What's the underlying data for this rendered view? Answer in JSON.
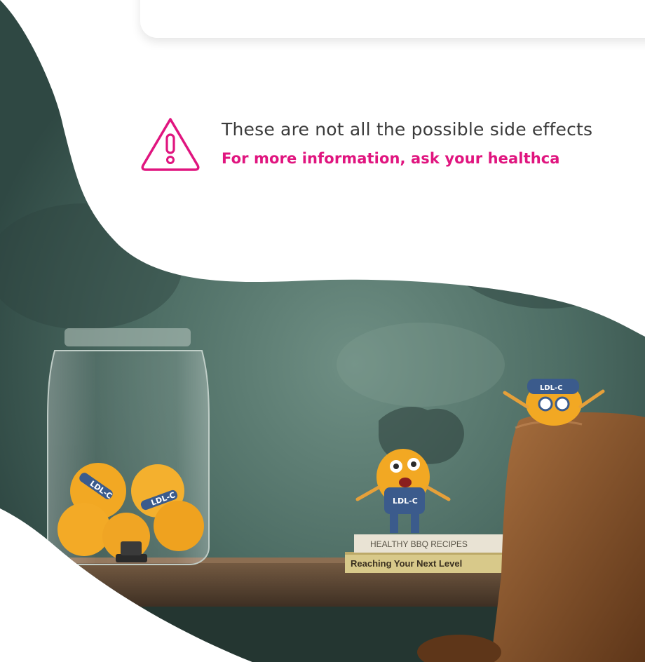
{
  "warning": {
    "icon": "warning-triangle-icon",
    "text": "These are not all the possible side effects",
    "cta": "For more information, ask your healthca"
  },
  "scene": {
    "jar_character_label_1": "LDL-C",
    "jar_character_label_2": "LDL-C",
    "standing_character_label": "LDL-C",
    "chair_character_label": "LDL-C",
    "book_top_title": "HEALTHY BBQ RECIPES",
    "book_bottom_title": "Reaching Your Next Level"
  },
  "colors": {
    "accent": "#e0157f",
    "wall": "#4f6f66",
    "shelf": "#5b4634",
    "chair": "#8a5530",
    "character": "#f2a823",
    "overalls": "#3b5b8c"
  }
}
